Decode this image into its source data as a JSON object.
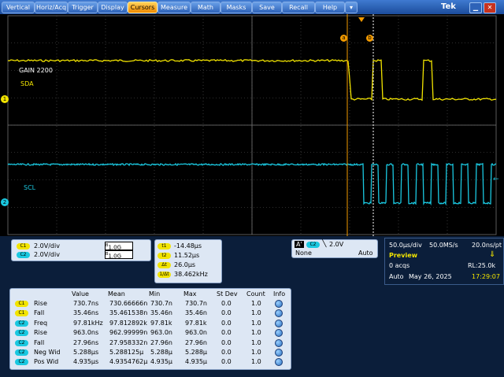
{
  "menu": {
    "items": [
      {
        "label": "Vertical",
        "active": false
      },
      {
        "label": "Horiz/Acq",
        "active": false
      },
      {
        "label": "Trigger",
        "active": false
      },
      {
        "label": "Display",
        "active": false
      },
      {
        "label": "Cursors",
        "active": true
      },
      {
        "label": "Measure",
        "active": false
      },
      {
        "label": "Math",
        "active": false
      },
      {
        "label": "Masks",
        "active": false
      },
      {
        "label": "Save",
        "active": false
      },
      {
        "label": "Recall",
        "active": false
      },
      {
        "label": "Help",
        "active": false
      },
      {
        "label": "▾",
        "active": false
      }
    ],
    "brand": "Tek"
  },
  "scope": {
    "cursor_a_label": "a",
    "cursor_b_label": "b",
    "ch1_label": "1",
    "ch2_label": "2",
    "sda_label": "SDA",
    "scl_label": "SCL",
    "gain_label": "GAIN 2200",
    "colors": {
      "ch1": "#f2e400",
      "ch2": "#1ac8e0",
      "cursor": "#f29a00",
      "grid": "#5a5a5a"
    }
  },
  "channels": [
    {
      "chip": "C1",
      "scale": "2.0V/div",
      "bw": "1.0G",
      "bw_prefix": "B"
    },
    {
      "chip": "C2",
      "scale": "2.0V/div",
      "bw": "1.0G",
      "bw_prefix": "B"
    }
  ],
  "cursors": {
    "t1": "-14.48μs",
    "t2": "11.52μs",
    "delta_t": "26.0μs",
    "inv_delta_t": "38.462kHz",
    "chips": [
      "t1",
      "t2",
      "Δt",
      "1/Δt"
    ]
  },
  "trigger": {
    "a_label": "A'",
    "source": "C2",
    "level": "2.0V",
    "coupling": "None",
    "mode": "Auto"
  },
  "acq": {
    "timebase": "50.0μs/div",
    "sample_rate": "50.0MS/s",
    "resolution": "20.0ns/pt",
    "state": "Preview",
    "acqs": "0 acqs",
    "record_length": "RL:25.0k",
    "mode": "Auto",
    "date": "May 26, 2025",
    "time": "17:29:07"
  },
  "measurements": {
    "headers": [
      "Value",
      "Mean",
      "Min",
      "Max",
      "St Dev",
      "Count",
      "Info"
    ],
    "rows": [
      {
        "src": "C1",
        "name": "Rise",
        "value": "730.7ns",
        "mean": "730.66666n",
        "min": "730.7n",
        "max": "730.7n",
        "stdev": "0.0",
        "count": "1.0"
      },
      {
        "src": "C1",
        "name": "Fall",
        "value": "35.46ns",
        "mean": "35.461538n",
        "min": "35.46n",
        "max": "35.46n",
        "stdev": "0.0",
        "count": "1.0"
      },
      {
        "src": "C2",
        "name": "Freq",
        "value": "97.81kHz",
        "mean": "97.812892k",
        "min": "97.81k",
        "max": "97.81k",
        "stdev": "0.0",
        "count": "1.0"
      },
      {
        "src": "C2",
        "name": "Rise",
        "value": "963.0ns",
        "mean": "962.99999n",
        "min": "963.0n",
        "max": "963.0n",
        "stdev": "0.0",
        "count": "1.0"
      },
      {
        "src": "C2",
        "name": "Fall",
        "value": "27.96ns",
        "mean": "27.958332n",
        "min": "27.96n",
        "max": "27.96n",
        "stdev": "0.0",
        "count": "1.0"
      },
      {
        "src": "C2",
        "name": "Neg Wid",
        "value": "5.288μs",
        "mean": "5.288125μ",
        "min": "5.288μ",
        "max": "5.288μ",
        "stdev": "0.0",
        "count": "1.0"
      },
      {
        "src": "C2",
        "name": "Pos Wid",
        "value": "4.935μs",
        "mean": "4.9354762μ",
        "min": "4.935μ",
        "max": "4.935μ",
        "stdev": "0.0",
        "count": "1.0"
      }
    ]
  }
}
